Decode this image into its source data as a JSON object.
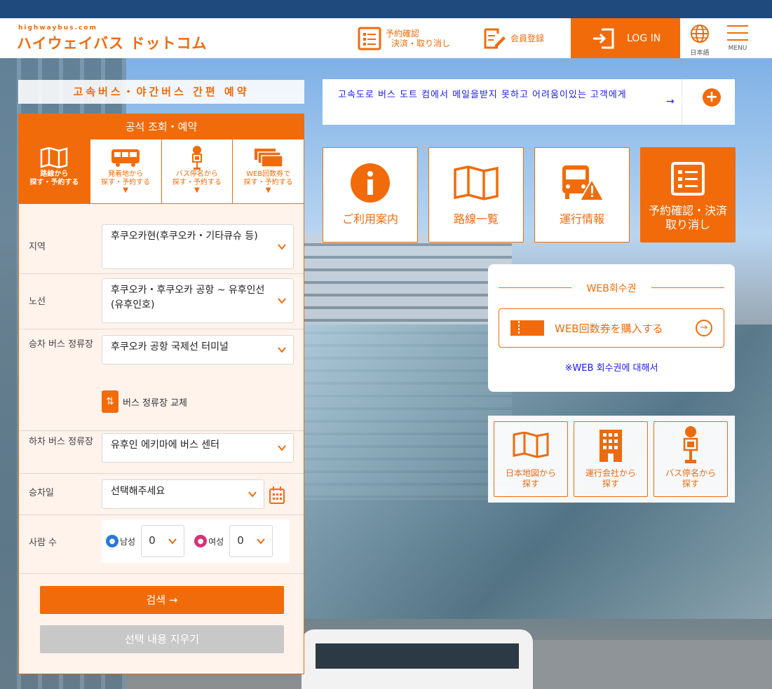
{
  "brand": {
    "sub": "highwaybus.com",
    "main": "ハイウェイバス ドットコム"
  },
  "header": {
    "reservation_line1": "予約確認",
    "reservation_line2": "決済・取り消し",
    "member_register": "会員登録",
    "login": "LOG IN",
    "language": "日本語",
    "menu": "MENU"
  },
  "easy_title": "고속버스・야간버스 간편 예약",
  "panel": {
    "header": "공석 조회・예약",
    "modes": [
      {
        "line1": "路線から",
        "line2": "探す・予約する"
      },
      {
        "line1": "発着地から",
        "line2": "探す・予約する"
      },
      {
        "line1": "バス停名から",
        "line2": "探す・予約する"
      },
      {
        "line1": "WEB回数券で",
        "line2": "探す・予約する"
      }
    ],
    "fields": {
      "region_label": "지역",
      "region_value": "후쿠오카현(후쿠오카・기타큐슈 등)",
      "route_label": "노선",
      "route_value": "후쿠오카・후쿠오카 공항 ~ 유후인선(유후인호)",
      "board_label": "승차 버스 정류장",
      "board_value": "후쿠오카 공항 국제선 터미널",
      "swap_label": "버스 정류장 교체",
      "alight_label": "하차 버스 정류장",
      "alight_value": "유후인 에키마에 버스 센터",
      "date_label": "승차일",
      "date_value": "선택해주세요",
      "people_label": "사람 수",
      "male_label": "남성",
      "male_value": "0",
      "female_label": "여성",
      "female_value": "0"
    },
    "search_button": "검색 →",
    "clear_button": "선택 내용 지우기"
  },
  "notice": {
    "text": "고속도로 버스 도트 컴에서 메일을받지 못하고 어려움이있는 고객에게"
  },
  "tiles": [
    {
      "label": "ご利用案内"
    },
    {
      "label": "路線一覧"
    },
    {
      "label": "運行情報"
    },
    {
      "label_line1": "予約確認・決済",
      "label_line2": "取り消し"
    }
  ],
  "web_coupon": {
    "title": "WEB회수권",
    "buy_button": "WEB回数券を購入する",
    "about_link": "※WEB 회수권에 대해서"
  },
  "search_tiles": [
    {
      "line1": "日本地図から",
      "line2": "探す"
    },
    {
      "line1": "運行会社から",
      "line2": "探す"
    },
    {
      "line1": "バス停名から",
      "line2": "探す"
    }
  ],
  "colors": {
    "accent": "#f26b0a",
    "topbar": "#1f4a7d",
    "link": "#1a1aee"
  }
}
